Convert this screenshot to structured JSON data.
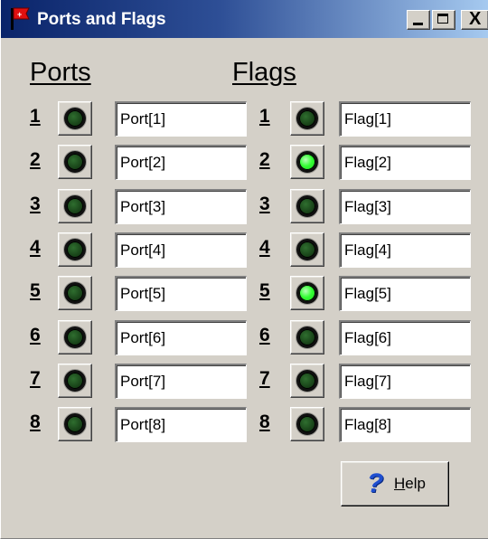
{
  "window": {
    "title": "Ports and Flags",
    "controls": [
      "minimize",
      "maximize",
      "close"
    ],
    "close_glyph": "X"
  },
  "ports": {
    "heading": "Ports",
    "rows": [
      {
        "number": "1",
        "name": "Port[1]",
        "led_on": false
      },
      {
        "number": "2",
        "name": "Port[2]",
        "led_on": false
      },
      {
        "number": "3",
        "name": "Port[3]",
        "led_on": false
      },
      {
        "number": "4",
        "name": "Port[4]",
        "led_on": false
      },
      {
        "number": "5",
        "name": "Port[5]",
        "led_on": false
      },
      {
        "number": "6",
        "name": "Port[6]",
        "led_on": false
      },
      {
        "number": "7",
        "name": "Port[7]",
        "led_on": false
      },
      {
        "number": "8",
        "name": "Port[8]",
        "led_on": false
      }
    ]
  },
  "flags": {
    "heading": "Flags",
    "rows": [
      {
        "number": "1",
        "name": "Flag[1]",
        "led_on": false
      },
      {
        "number": "2",
        "name": "Flag[2]",
        "led_on": true
      },
      {
        "number": "3",
        "name": "Flag[3]",
        "led_on": false
      },
      {
        "number": "4",
        "name": "Flag[4]",
        "led_on": false
      },
      {
        "number": "5",
        "name": "Flag[5]",
        "led_on": true
      },
      {
        "number": "6",
        "name": "Flag[6]",
        "led_on": false
      },
      {
        "number": "7",
        "name": "Flag[7]",
        "led_on": false
      },
      {
        "number": "8",
        "name": "Flag[8]",
        "led_on": false
      }
    ]
  },
  "help_button": {
    "icon": "question-icon",
    "label": "Help",
    "mnemonic": "H"
  },
  "colors": {
    "led_off": "#1a461a",
    "led_on": "#33ff33",
    "titlebar_start": "#0a246a",
    "titlebar_end": "#a6caf0",
    "face": "#d4d0c8"
  }
}
